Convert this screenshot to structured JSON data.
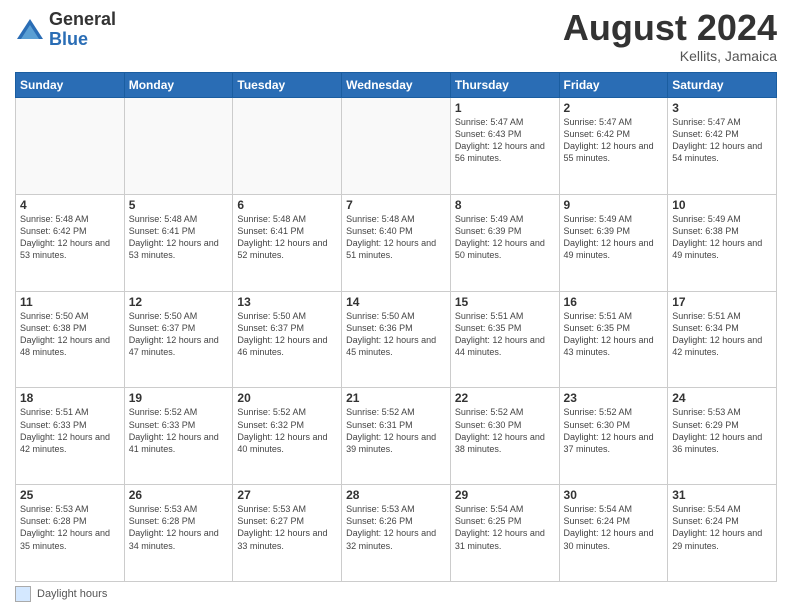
{
  "header": {
    "logo_general": "General",
    "logo_blue": "Blue",
    "month_year": "August 2024",
    "location": "Kellits, Jamaica"
  },
  "footer": {
    "legend_label": "Daylight hours"
  },
  "days_of_week": [
    "Sunday",
    "Monday",
    "Tuesday",
    "Wednesday",
    "Thursday",
    "Friday",
    "Saturday"
  ],
  "weeks": [
    [
      {
        "day": "",
        "empty": true
      },
      {
        "day": "",
        "empty": true
      },
      {
        "day": "",
        "empty": true
      },
      {
        "day": "",
        "empty": true
      },
      {
        "day": "1",
        "sunrise": "5:47 AM",
        "sunset": "6:43 PM",
        "daylight": "12 hours and 56 minutes."
      },
      {
        "day": "2",
        "sunrise": "5:47 AM",
        "sunset": "6:42 PM",
        "daylight": "12 hours and 55 minutes."
      },
      {
        "day": "3",
        "sunrise": "5:47 AM",
        "sunset": "6:42 PM",
        "daylight": "12 hours and 54 minutes."
      }
    ],
    [
      {
        "day": "4",
        "sunrise": "5:48 AM",
        "sunset": "6:42 PM",
        "daylight": "12 hours and 53 minutes."
      },
      {
        "day": "5",
        "sunrise": "5:48 AM",
        "sunset": "6:41 PM",
        "daylight": "12 hours and 53 minutes."
      },
      {
        "day": "6",
        "sunrise": "5:48 AM",
        "sunset": "6:41 PM",
        "daylight": "12 hours and 52 minutes."
      },
      {
        "day": "7",
        "sunrise": "5:48 AM",
        "sunset": "6:40 PM",
        "daylight": "12 hours and 51 minutes."
      },
      {
        "day": "8",
        "sunrise": "5:49 AM",
        "sunset": "6:39 PM",
        "daylight": "12 hours and 50 minutes."
      },
      {
        "day": "9",
        "sunrise": "5:49 AM",
        "sunset": "6:39 PM",
        "daylight": "12 hours and 49 minutes."
      },
      {
        "day": "10",
        "sunrise": "5:49 AM",
        "sunset": "6:38 PM",
        "daylight": "12 hours and 49 minutes."
      }
    ],
    [
      {
        "day": "11",
        "sunrise": "5:50 AM",
        "sunset": "6:38 PM",
        "daylight": "12 hours and 48 minutes."
      },
      {
        "day": "12",
        "sunrise": "5:50 AM",
        "sunset": "6:37 PM",
        "daylight": "12 hours and 47 minutes."
      },
      {
        "day": "13",
        "sunrise": "5:50 AM",
        "sunset": "6:37 PM",
        "daylight": "12 hours and 46 minutes."
      },
      {
        "day": "14",
        "sunrise": "5:50 AM",
        "sunset": "6:36 PM",
        "daylight": "12 hours and 45 minutes."
      },
      {
        "day": "15",
        "sunrise": "5:51 AM",
        "sunset": "6:35 PM",
        "daylight": "12 hours and 44 minutes."
      },
      {
        "day": "16",
        "sunrise": "5:51 AM",
        "sunset": "6:35 PM",
        "daylight": "12 hours and 43 minutes."
      },
      {
        "day": "17",
        "sunrise": "5:51 AM",
        "sunset": "6:34 PM",
        "daylight": "12 hours and 42 minutes."
      }
    ],
    [
      {
        "day": "18",
        "sunrise": "5:51 AM",
        "sunset": "6:33 PM",
        "daylight": "12 hours and 42 minutes."
      },
      {
        "day": "19",
        "sunrise": "5:52 AM",
        "sunset": "6:33 PM",
        "daylight": "12 hours and 41 minutes."
      },
      {
        "day": "20",
        "sunrise": "5:52 AM",
        "sunset": "6:32 PM",
        "daylight": "12 hours and 40 minutes."
      },
      {
        "day": "21",
        "sunrise": "5:52 AM",
        "sunset": "6:31 PM",
        "daylight": "12 hours and 39 minutes."
      },
      {
        "day": "22",
        "sunrise": "5:52 AM",
        "sunset": "6:30 PM",
        "daylight": "12 hours and 38 minutes."
      },
      {
        "day": "23",
        "sunrise": "5:52 AM",
        "sunset": "6:30 PM",
        "daylight": "12 hours and 37 minutes."
      },
      {
        "day": "24",
        "sunrise": "5:53 AM",
        "sunset": "6:29 PM",
        "daylight": "12 hours and 36 minutes."
      }
    ],
    [
      {
        "day": "25",
        "sunrise": "5:53 AM",
        "sunset": "6:28 PM",
        "daylight": "12 hours and 35 minutes."
      },
      {
        "day": "26",
        "sunrise": "5:53 AM",
        "sunset": "6:28 PM",
        "daylight": "12 hours and 34 minutes."
      },
      {
        "day": "27",
        "sunrise": "5:53 AM",
        "sunset": "6:27 PM",
        "daylight": "12 hours and 33 minutes."
      },
      {
        "day": "28",
        "sunrise": "5:53 AM",
        "sunset": "6:26 PM",
        "daylight": "12 hours and 32 minutes."
      },
      {
        "day": "29",
        "sunrise": "5:54 AM",
        "sunset": "6:25 PM",
        "daylight": "12 hours and 31 minutes."
      },
      {
        "day": "30",
        "sunrise": "5:54 AM",
        "sunset": "6:24 PM",
        "daylight": "12 hours and 30 minutes."
      },
      {
        "day": "31",
        "sunrise": "5:54 AM",
        "sunset": "6:24 PM",
        "daylight": "12 hours and 29 minutes."
      }
    ]
  ]
}
